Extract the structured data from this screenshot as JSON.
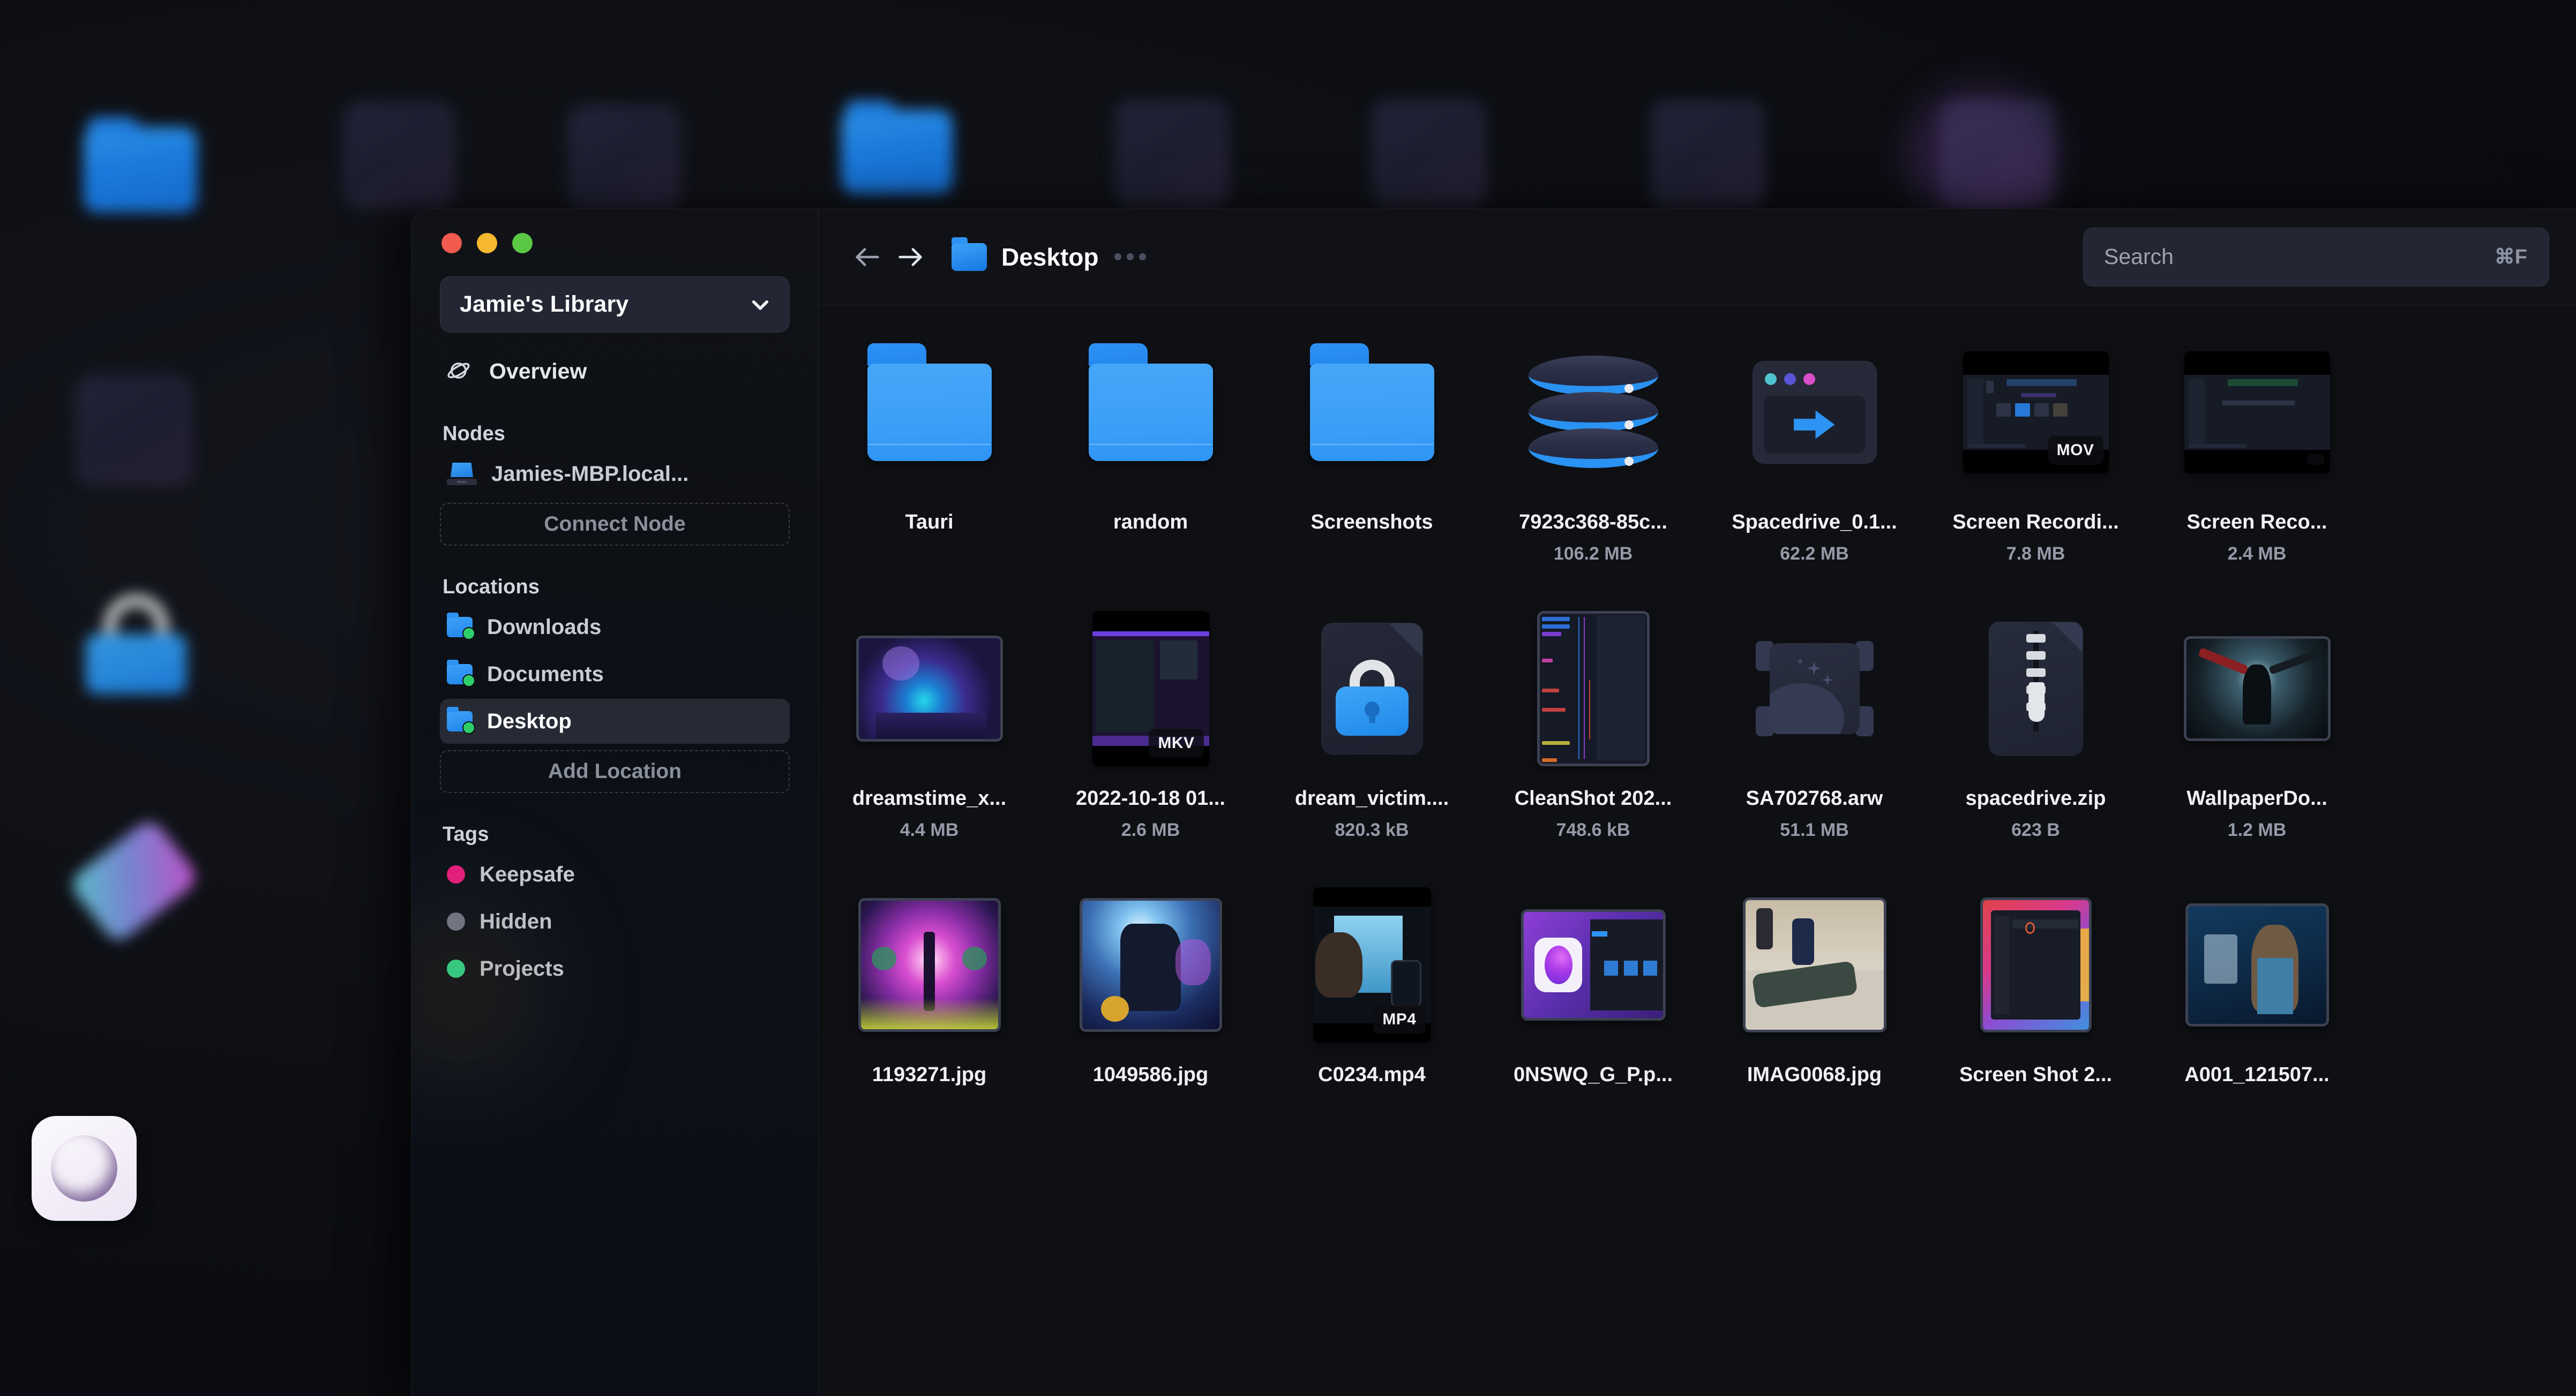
{
  "window": {
    "traffic_lights": [
      {
        "name": "close",
        "color": "#f05a4f"
      },
      {
        "name": "minimize",
        "color": "#f5b82e"
      },
      {
        "name": "maximize",
        "color": "#5bc845"
      }
    ]
  },
  "sidebar": {
    "library": {
      "name": "Jamie's Library",
      "chevron_icon": "chevron-down-icon"
    },
    "overview": {
      "label": "Overview",
      "icon": "planet-icon"
    },
    "sections": [
      {
        "title": "Nodes",
        "items": [
          {
            "label": "Jamies-MBP.local...",
            "icon": "laptop-icon"
          }
        ],
        "action": "Connect Node"
      },
      {
        "title": "Locations",
        "items": [
          {
            "label": "Downloads",
            "icon": "folder-icon",
            "selected": false
          },
          {
            "label": "Documents",
            "icon": "folder-icon",
            "selected": false
          },
          {
            "label": "Desktop",
            "icon": "folder-icon",
            "selected": true
          }
        ],
        "action": "Add Location"
      },
      {
        "title": "Tags",
        "items": [
          {
            "label": "Keepsafe",
            "color": "#ec1e7f"
          },
          {
            "label": "Hidden",
            "color": "#767a8c"
          },
          {
            "label": "Projects",
            "color": "#2fdd8e"
          }
        ]
      }
    ]
  },
  "toolbar": {
    "back_icon": "arrow-left-icon",
    "forward_icon": "arrow-right-icon",
    "breadcrumb": {
      "icon": "folder-icon",
      "label": "Desktop"
    },
    "more_icon": "ellipsis-icon",
    "search": {
      "placeholder": "Search",
      "shortcut": "⌘F"
    }
  },
  "files": {
    "rows": [
      [
        {
          "name": "Tauri",
          "size": "",
          "kind": "folder"
        },
        {
          "name": "random",
          "size": "",
          "kind": "folder"
        },
        {
          "name": "Screenshots",
          "size": "",
          "kind": "folder"
        },
        {
          "name": "7923c368-85c...",
          "size": "106.2 MB",
          "kind": "database"
        },
        {
          "name": "Spacedrive_0.1...",
          "size": "62.2 MB",
          "kind": "app"
        },
        {
          "name": "Screen Recordi...",
          "size": "7.8 MB",
          "kind": "video",
          "badge": "MOV"
        },
        {
          "name": "Screen Reco...",
          "size": "2.4 MB",
          "kind": "video",
          "badge": ""
        }
      ],
      [
        {
          "name": "dreamstime_x...",
          "size": "4.4 MB",
          "kind": "image"
        },
        {
          "name": "2022-10-18 01...",
          "size": "2.6 MB",
          "kind": "video",
          "badge": "MKV"
        },
        {
          "name": "dream_victim....",
          "size": "820.3 kB",
          "kind": "encrypted"
        },
        {
          "name": "CleanShot 202...",
          "size": "748.6 kB",
          "kind": "screenshot"
        },
        {
          "name": "SA702768.arw",
          "size": "51.1 MB",
          "kind": "raw"
        },
        {
          "name": "spacedrive.zip",
          "size": "623 B",
          "kind": "zip"
        },
        {
          "name": "WallpaperDo...",
          "size": "1.2 MB",
          "kind": "image"
        }
      ],
      [
        {
          "name": "1193271.jpg",
          "size": "",
          "kind": "image"
        },
        {
          "name": "1049586.jpg",
          "size": "",
          "kind": "image"
        },
        {
          "name": "C0234.mp4",
          "size": "",
          "kind": "video",
          "badge": "MP4"
        },
        {
          "name": "0NSWQ_G_P.p...",
          "size": "",
          "kind": "image"
        },
        {
          "name": "IMAG0068.jpg",
          "size": "",
          "kind": "image"
        },
        {
          "name": "Screen Shot 2...",
          "size": "",
          "kind": "image"
        },
        {
          "name": "A001_121507...",
          "size": "",
          "kind": "image"
        }
      ]
    ]
  },
  "desktop": {
    "app_icon": {
      "name": "spacedrive-app-icon"
    }
  },
  "colors": {
    "accent": "#2e94f4",
    "window_bg": "#0f1116",
    "sidebar_bg": "#0d1015",
    "selected_bg": "#262a35"
  }
}
